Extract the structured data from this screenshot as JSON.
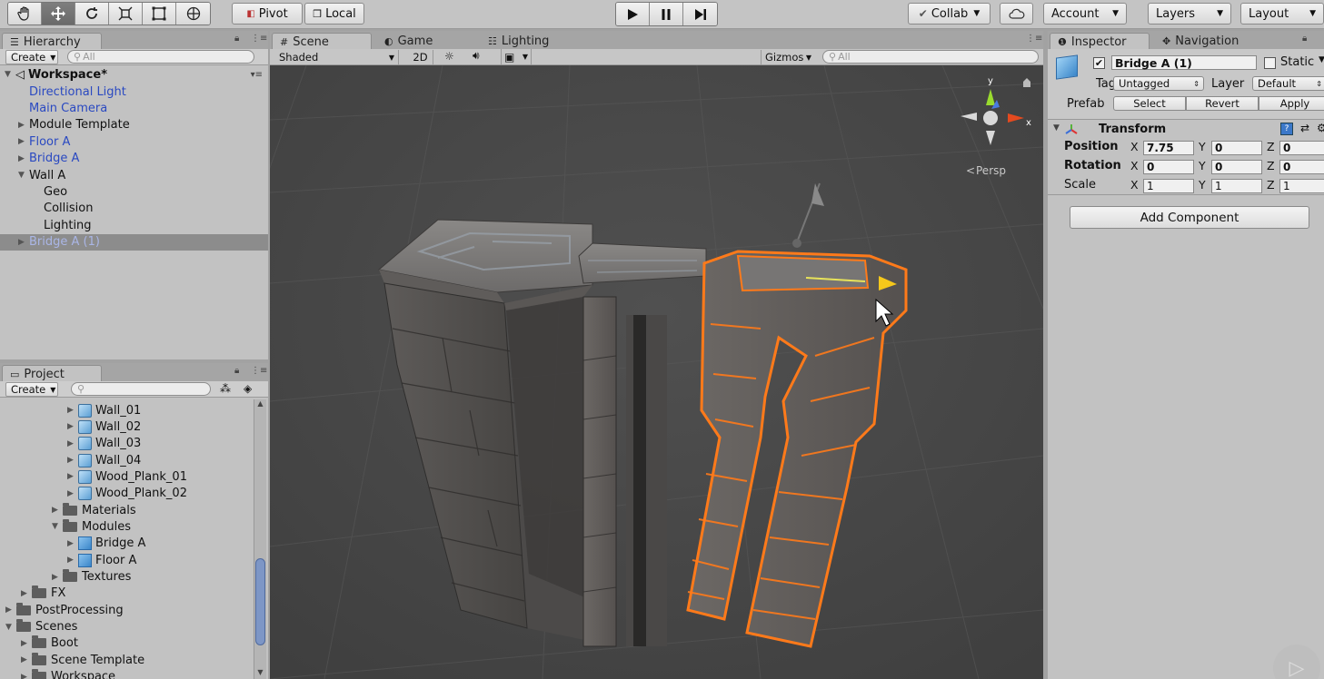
{
  "toolbar": {
    "pivot_label": "Pivot",
    "local_label": "Local",
    "collab_label": "Collab",
    "account_label": "Account",
    "layers_label": "Layers",
    "layout_label": "Layout"
  },
  "hierarchy": {
    "tab_label": "Hierarchy",
    "create_label": "Create",
    "search_placeholder": "All",
    "scene_name": "Workspace*",
    "items": [
      {
        "label": "Directional Light",
        "indent": 1,
        "expander": "",
        "prefab": true
      },
      {
        "label": "Main Camera",
        "indent": 1,
        "expander": "",
        "prefab": true
      },
      {
        "label": "Module Template",
        "indent": 1,
        "expander": "▶",
        "prefab": false
      },
      {
        "label": "Floor A",
        "indent": 1,
        "expander": "▶",
        "prefab": true
      },
      {
        "label": "Bridge A",
        "indent": 1,
        "expander": "▶",
        "prefab": true
      },
      {
        "label": "Wall A",
        "indent": 1,
        "expander": "▼",
        "prefab": false
      },
      {
        "label": "Geo",
        "indent": 2,
        "expander": "",
        "prefab": false
      },
      {
        "label": "Collision",
        "indent": 2,
        "expander": "",
        "prefab": false
      },
      {
        "label": "Lighting",
        "indent": 2,
        "expander": "",
        "prefab": false
      },
      {
        "label": "Bridge A (1)",
        "indent": 1,
        "expander": "▶",
        "prefab": true,
        "selected": true
      }
    ]
  },
  "project": {
    "tab_label": "Project",
    "create_label": "Create",
    "items": [
      {
        "label": "Wall_01",
        "level": 4,
        "icon": "mesh",
        "expander": "▶"
      },
      {
        "label": "Wall_02",
        "level": 4,
        "icon": "mesh",
        "expander": "▶"
      },
      {
        "label": "Wall_03",
        "level": 4,
        "icon": "mesh",
        "expander": "▶"
      },
      {
        "label": "Wall_04",
        "level": 4,
        "icon": "mesh",
        "expander": "▶"
      },
      {
        "label": "Wood_Plank_01",
        "level": 4,
        "icon": "mesh",
        "expander": "▶"
      },
      {
        "label": "Wood_Plank_02",
        "level": 4,
        "icon": "mesh",
        "expander": "▶"
      },
      {
        "label": "Materials",
        "level": 3,
        "icon": "folder",
        "expander": "▶"
      },
      {
        "label": "Modules",
        "level": 3,
        "icon": "folder",
        "expander": "▼"
      },
      {
        "label": "Bridge A",
        "level": 4,
        "icon": "prefab",
        "expander": "▶"
      },
      {
        "label": "Floor A",
        "level": 4,
        "icon": "prefab",
        "expander": "▶"
      },
      {
        "label": "Textures",
        "level": 3,
        "icon": "folder",
        "expander": "▶"
      },
      {
        "label": "FX",
        "level": 1,
        "icon": "folder",
        "expander": "▶"
      },
      {
        "label": "PostProcessing",
        "level": 0,
        "icon": "folder",
        "expander": "▶"
      },
      {
        "label": "Scenes",
        "level": 0,
        "icon": "folder",
        "expander": "▼"
      },
      {
        "label": "Boot",
        "level": 1,
        "icon": "folder",
        "expander": "▶"
      },
      {
        "label": "Scene Template",
        "level": 1,
        "icon": "folder",
        "expander": "▶"
      },
      {
        "label": "Workspace",
        "level": 1,
        "icon": "folder",
        "expander": "▶"
      }
    ]
  },
  "scene": {
    "tabs": [
      "Scene",
      "Game",
      "Lighting"
    ],
    "shading_mode": "Shaded",
    "mode_2d_label": "2D",
    "gizmos_label": "Gizmos",
    "search_placeholder": "All",
    "persp_label": "Persp",
    "axis_x": "x",
    "axis_y": "y"
  },
  "inspector": {
    "tabs": [
      "Inspector",
      "Navigation"
    ],
    "object_name": "Bridge A (1)",
    "static_label": "Static",
    "tag_label": "Tag",
    "tag_value": "Untagged",
    "layer_label": "Layer",
    "layer_value": "Default",
    "prefab_label": "Prefab",
    "prefab_select": "Select",
    "prefab_revert": "Revert",
    "prefab_apply": "Apply",
    "transform_title": "Transform",
    "position_label": "Position",
    "rotation_label": "Rotation",
    "scale_label": "Scale",
    "axis": {
      "x": "X",
      "y": "Y",
      "z": "Z"
    },
    "position": {
      "x": "7.75",
      "y": "0",
      "z": "0"
    },
    "rotation": {
      "x": "0",
      "y": "0",
      "z": "0"
    },
    "scale": {
      "x": "1",
      "y": "1",
      "z": "1"
    },
    "add_component_label": "Add Component"
  },
  "colors": {
    "selection_outline": "#ff7a1a",
    "prefab_text": "#2a49c1",
    "viewport_bg": "#484848"
  }
}
